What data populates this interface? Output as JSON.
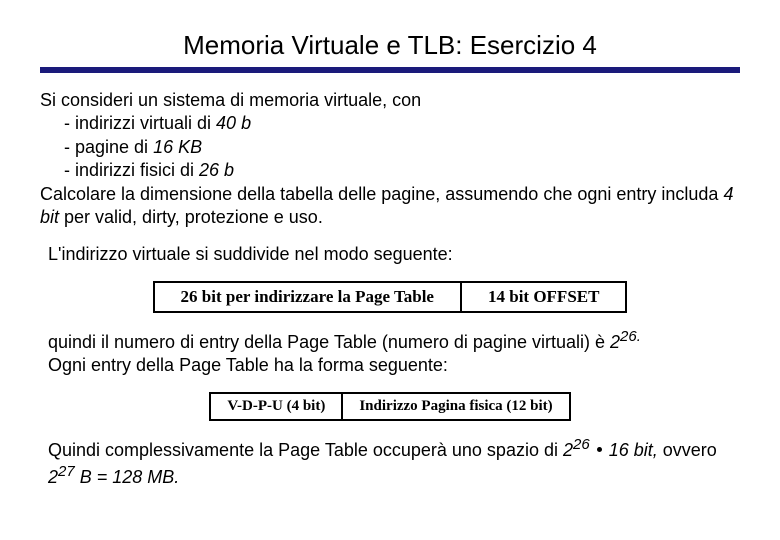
{
  "title": "Memoria Virtuale e TLB: Esercizio 4",
  "p1": {
    "intro": "Si consideri un sistema di memoria virtuale, con",
    "li1_a": "- indirizzi virtuali di ",
    "li1_b": "40 b",
    "li2_a": "- pagine di ",
    "li2_b": "16 KB",
    "li3_a": "- indirizzi fisici di ",
    "li3_b": "26 b",
    "calc_a": "Calcolare la dimensione della tabella delle pagine, assumendo che ogni entry includa ",
    "calc_b": "4 bit",
    "calc_c": " per valid, dirty, protezione e uso."
  },
  "p2": "L'indirizzo virtuale si suddivide nel modo seguente:",
  "table1": {
    "left": "26 bit per indirizzare la Page Table",
    "right": "14 bit OFFSET"
  },
  "p3": {
    "a": "quindi il numero di entry della Page Table (numero di pagine virtuali) è ",
    "b": "2",
    "c": "26.",
    "d": "Ogni entry della Page Table ha la forma seguente:"
  },
  "table2": {
    "left": "V-D-P-U (4 bit)",
    "right": "Indirizzo Pagina fisica (12 bit)"
  },
  "p4": {
    "a": "Quindi complessivamente la Page Table occuperà uno spazio di ",
    "b": "2",
    "c": "26",
    "d": "16 bit,",
    "e": " ovvero ",
    "f": "2",
    "g": "27",
    "h": " B = 128 MB."
  }
}
